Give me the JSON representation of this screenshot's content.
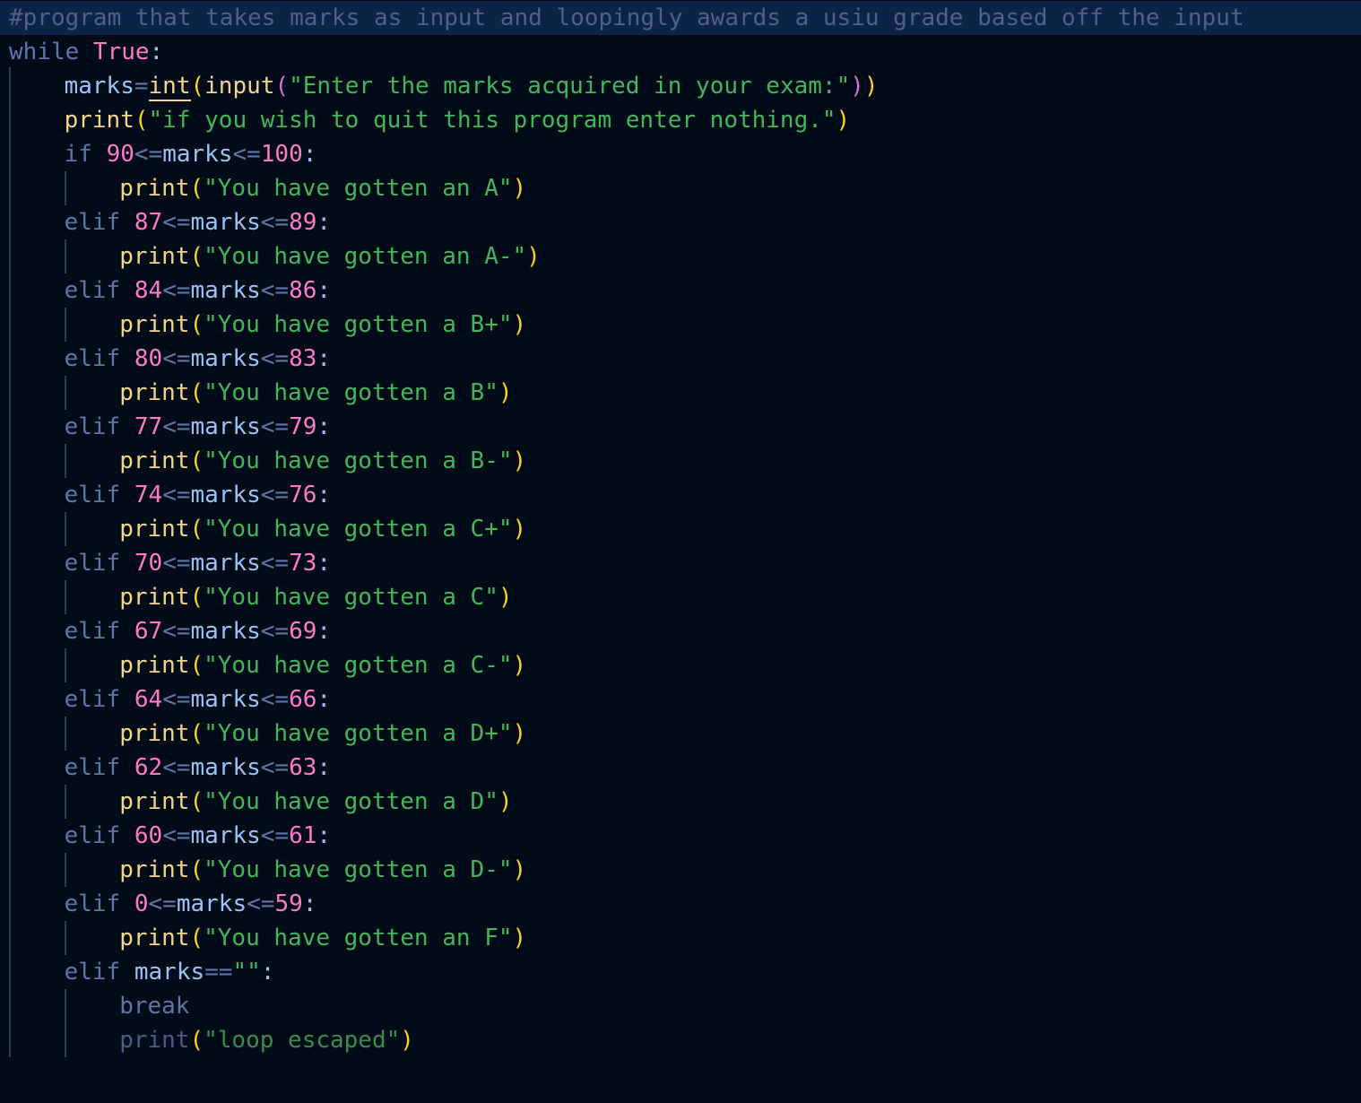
{
  "editor": {
    "language": "python",
    "theme_colors": {
      "background": "#010c18",
      "line_highlight": "#0d2346",
      "comment": "#4d6188",
      "keyword": "#5f76a8",
      "constant": "#ff79c6",
      "variable": "#9ec2f5",
      "function": "#f3d48a",
      "paren": "#ffd11a",
      "paren_nested": "#da70d6",
      "string": "#46b55a",
      "number": "#ff79c6",
      "indent_guide": "#2f3c55"
    },
    "lines": [
      {
        "indent": 0,
        "highlight": true,
        "tokens": [
          {
            "t": "#program that takes marks as input and loopingly awards a usiu grade based off the input",
            "c": "comment"
          }
        ]
      },
      {
        "indent": 0,
        "tokens": [
          {
            "t": "while ",
            "c": "kw"
          },
          {
            "t": "True",
            "c": "const"
          },
          {
            "t": ":",
            "c": "punct"
          }
        ]
      },
      {
        "indent": 4,
        "tokens": [
          {
            "t": "marks",
            "c": "var"
          },
          {
            "t": "=",
            "c": "op"
          },
          {
            "t": "int",
            "c": "builtin"
          },
          {
            "t": "(",
            "c": "paren"
          },
          {
            "t": "input",
            "c": "func"
          },
          {
            "t": "(",
            "c": "paren2"
          },
          {
            "t": "\"Enter the marks acquired in your exam:\"",
            "c": "str"
          },
          {
            "t": ")",
            "c": "paren2"
          },
          {
            "t": ")",
            "c": "paren"
          }
        ]
      },
      {
        "indent": 4,
        "tokens": [
          {
            "t": "print",
            "c": "func"
          },
          {
            "t": "(",
            "c": "paren"
          },
          {
            "t": "\"if you wish to quit this program enter nothing.\"",
            "c": "str"
          },
          {
            "t": ")",
            "c": "paren"
          }
        ]
      },
      {
        "indent": 4,
        "tokens": [
          {
            "t": "if ",
            "c": "kw"
          },
          {
            "t": "90",
            "c": "num"
          },
          {
            "t": "<=",
            "c": "op"
          },
          {
            "t": "marks",
            "c": "var"
          },
          {
            "t": "<=",
            "c": "op"
          },
          {
            "t": "100",
            "c": "num"
          },
          {
            "t": ":",
            "c": "punct"
          }
        ]
      },
      {
        "indent": 8,
        "tokens": [
          {
            "t": "print",
            "c": "func"
          },
          {
            "t": "(",
            "c": "paren"
          },
          {
            "t": "\"You have gotten an A\"",
            "c": "str"
          },
          {
            "t": ")",
            "c": "paren"
          }
        ]
      },
      {
        "indent": 4,
        "tokens": [
          {
            "t": "elif ",
            "c": "kw"
          },
          {
            "t": "87",
            "c": "num"
          },
          {
            "t": "<=",
            "c": "op"
          },
          {
            "t": "marks",
            "c": "var"
          },
          {
            "t": "<=",
            "c": "op"
          },
          {
            "t": "89",
            "c": "num"
          },
          {
            "t": ":",
            "c": "punct"
          }
        ]
      },
      {
        "indent": 8,
        "tokens": [
          {
            "t": "print",
            "c": "func"
          },
          {
            "t": "(",
            "c": "paren"
          },
          {
            "t": "\"You have gotten an A-\"",
            "c": "str"
          },
          {
            "t": ")",
            "c": "paren"
          }
        ]
      },
      {
        "indent": 4,
        "tokens": [
          {
            "t": "elif ",
            "c": "kw"
          },
          {
            "t": "84",
            "c": "num"
          },
          {
            "t": "<=",
            "c": "op"
          },
          {
            "t": "marks",
            "c": "var"
          },
          {
            "t": "<=",
            "c": "op"
          },
          {
            "t": "86",
            "c": "num"
          },
          {
            "t": ":",
            "c": "punct"
          }
        ]
      },
      {
        "indent": 8,
        "tokens": [
          {
            "t": "print",
            "c": "func"
          },
          {
            "t": "(",
            "c": "paren"
          },
          {
            "t": "\"You have gotten a B+\"",
            "c": "str"
          },
          {
            "t": ")",
            "c": "paren"
          }
        ]
      },
      {
        "indent": 4,
        "tokens": [
          {
            "t": "elif ",
            "c": "kw"
          },
          {
            "t": "80",
            "c": "num"
          },
          {
            "t": "<=",
            "c": "op"
          },
          {
            "t": "marks",
            "c": "var"
          },
          {
            "t": "<=",
            "c": "op"
          },
          {
            "t": "83",
            "c": "num"
          },
          {
            "t": ":",
            "c": "punct"
          }
        ]
      },
      {
        "indent": 8,
        "tokens": [
          {
            "t": "print",
            "c": "func"
          },
          {
            "t": "(",
            "c": "paren"
          },
          {
            "t": "\"You have gotten a B\"",
            "c": "str"
          },
          {
            "t": ")",
            "c": "paren"
          }
        ]
      },
      {
        "indent": 4,
        "tokens": [
          {
            "t": "elif ",
            "c": "kw"
          },
          {
            "t": "77",
            "c": "num"
          },
          {
            "t": "<=",
            "c": "op"
          },
          {
            "t": "marks",
            "c": "var"
          },
          {
            "t": "<=",
            "c": "op"
          },
          {
            "t": "79",
            "c": "num"
          },
          {
            "t": ":",
            "c": "punct"
          }
        ]
      },
      {
        "indent": 8,
        "tokens": [
          {
            "t": "print",
            "c": "func"
          },
          {
            "t": "(",
            "c": "paren"
          },
          {
            "t": "\"You have gotten a B-\"",
            "c": "str"
          },
          {
            "t": ")",
            "c": "paren"
          }
        ]
      },
      {
        "indent": 4,
        "tokens": [
          {
            "t": "elif ",
            "c": "kw"
          },
          {
            "t": "74",
            "c": "num"
          },
          {
            "t": "<=",
            "c": "op"
          },
          {
            "t": "marks",
            "c": "var"
          },
          {
            "t": "<=",
            "c": "op"
          },
          {
            "t": "76",
            "c": "num"
          },
          {
            "t": ":",
            "c": "punct"
          }
        ]
      },
      {
        "indent": 8,
        "tokens": [
          {
            "t": "print",
            "c": "func"
          },
          {
            "t": "(",
            "c": "paren"
          },
          {
            "t": "\"You have gotten a C+\"",
            "c": "str"
          },
          {
            "t": ")",
            "c": "paren"
          }
        ]
      },
      {
        "indent": 4,
        "tokens": [
          {
            "t": "elif ",
            "c": "kw"
          },
          {
            "t": "70",
            "c": "num"
          },
          {
            "t": "<=",
            "c": "op"
          },
          {
            "t": "marks",
            "c": "var"
          },
          {
            "t": "<=",
            "c": "op"
          },
          {
            "t": "73",
            "c": "num"
          },
          {
            "t": ":",
            "c": "punct"
          }
        ]
      },
      {
        "indent": 8,
        "tokens": [
          {
            "t": "print",
            "c": "func"
          },
          {
            "t": "(",
            "c": "paren"
          },
          {
            "t": "\"You have gotten a C\"",
            "c": "str"
          },
          {
            "t": ")",
            "c": "paren"
          }
        ]
      },
      {
        "indent": 4,
        "tokens": [
          {
            "t": "elif ",
            "c": "kw"
          },
          {
            "t": "67",
            "c": "num"
          },
          {
            "t": "<=",
            "c": "op"
          },
          {
            "t": "marks",
            "c": "var"
          },
          {
            "t": "<=",
            "c": "op"
          },
          {
            "t": "69",
            "c": "num"
          },
          {
            "t": ":",
            "c": "punct"
          }
        ]
      },
      {
        "indent": 8,
        "tokens": [
          {
            "t": "print",
            "c": "func"
          },
          {
            "t": "(",
            "c": "paren"
          },
          {
            "t": "\"You have gotten a C-\"",
            "c": "str"
          },
          {
            "t": ")",
            "c": "paren"
          }
        ]
      },
      {
        "indent": 4,
        "tokens": [
          {
            "t": "elif ",
            "c": "kw"
          },
          {
            "t": "64",
            "c": "num"
          },
          {
            "t": "<=",
            "c": "op"
          },
          {
            "t": "marks",
            "c": "var"
          },
          {
            "t": "<=",
            "c": "op"
          },
          {
            "t": "66",
            "c": "num"
          },
          {
            "t": ":",
            "c": "punct"
          }
        ]
      },
      {
        "indent": 8,
        "tokens": [
          {
            "t": "print",
            "c": "func"
          },
          {
            "t": "(",
            "c": "paren"
          },
          {
            "t": "\"You have gotten a D+\"",
            "c": "str"
          },
          {
            "t": ")",
            "c": "paren"
          }
        ]
      },
      {
        "indent": 4,
        "tokens": [
          {
            "t": "elif ",
            "c": "kw"
          },
          {
            "t": "62",
            "c": "num"
          },
          {
            "t": "<=",
            "c": "op"
          },
          {
            "t": "marks",
            "c": "var"
          },
          {
            "t": "<=",
            "c": "op"
          },
          {
            "t": "63",
            "c": "num"
          },
          {
            "t": ":",
            "c": "punct"
          }
        ]
      },
      {
        "indent": 8,
        "tokens": [
          {
            "t": "print",
            "c": "func"
          },
          {
            "t": "(",
            "c": "paren"
          },
          {
            "t": "\"You have gotten a D\"",
            "c": "str"
          },
          {
            "t": ")",
            "c": "paren"
          }
        ]
      },
      {
        "indent": 4,
        "tokens": [
          {
            "t": "elif ",
            "c": "kw"
          },
          {
            "t": "60",
            "c": "num"
          },
          {
            "t": "<=",
            "c": "op"
          },
          {
            "t": "marks",
            "c": "var"
          },
          {
            "t": "<=",
            "c": "op"
          },
          {
            "t": "61",
            "c": "num"
          },
          {
            "t": ":",
            "c": "punct"
          }
        ]
      },
      {
        "indent": 8,
        "tokens": [
          {
            "t": "print",
            "c": "func"
          },
          {
            "t": "(",
            "c": "paren"
          },
          {
            "t": "\"You have gotten a D-\"",
            "c": "str"
          },
          {
            "t": ")",
            "c": "paren"
          }
        ]
      },
      {
        "indent": 4,
        "tokens": [
          {
            "t": "elif ",
            "c": "kw"
          },
          {
            "t": "0",
            "c": "num"
          },
          {
            "t": "<=",
            "c": "op"
          },
          {
            "t": "marks",
            "c": "var"
          },
          {
            "t": "<=",
            "c": "op"
          },
          {
            "t": "59",
            "c": "num"
          },
          {
            "t": ":",
            "c": "punct"
          }
        ]
      },
      {
        "indent": 8,
        "tokens": [
          {
            "t": "print",
            "c": "func"
          },
          {
            "t": "(",
            "c": "paren"
          },
          {
            "t": "\"You have gotten an F\"",
            "c": "str"
          },
          {
            "t": ")",
            "c": "paren"
          }
        ]
      },
      {
        "indent": 4,
        "tokens": [
          {
            "t": "elif ",
            "c": "kw"
          },
          {
            "t": "marks",
            "c": "var"
          },
          {
            "t": "==",
            "c": "op"
          },
          {
            "t": "\"\"",
            "c": "str"
          },
          {
            "t": ":",
            "c": "punct"
          }
        ]
      },
      {
        "indent": 8,
        "tokens": [
          {
            "t": "break",
            "c": "kw"
          }
        ]
      },
      {
        "indent": 8,
        "tokens": [
          {
            "t": "print",
            "c": "dim"
          },
          {
            "t": "(",
            "c": "paren"
          },
          {
            "t": "\"loop escaped\"",
            "c": "dimstr"
          },
          {
            "t": ")",
            "c": "paren"
          }
        ]
      }
    ]
  }
}
